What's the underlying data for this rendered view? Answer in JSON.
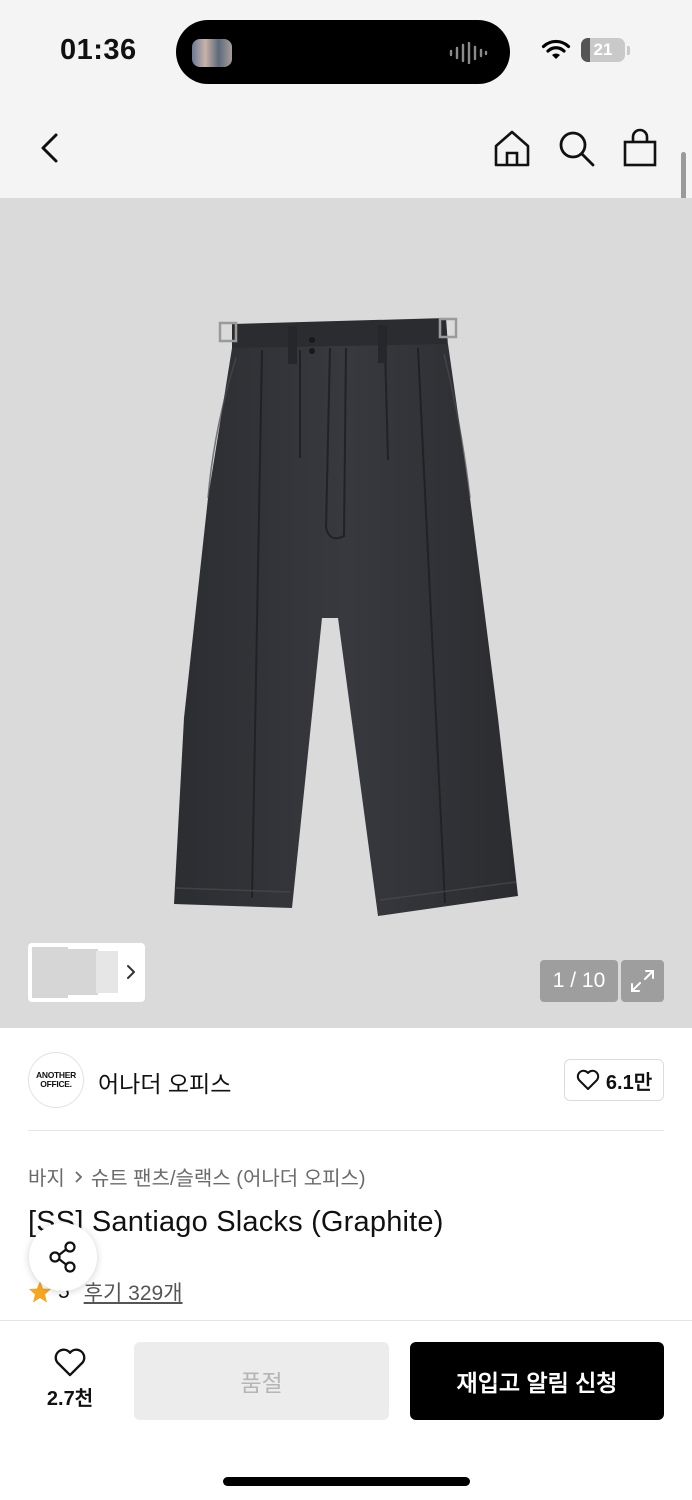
{
  "status": {
    "time": "01:36",
    "battery": "21"
  },
  "gallery": {
    "counter": "1 / 10",
    "battery_level": 0.21
  },
  "brand": {
    "logo_line1": "ANOTHER",
    "logo_line2": "OFFICE.",
    "name": "어나더 오피스",
    "likes": "6.1만"
  },
  "breadcrumb": {
    "level1": "바지",
    "level2": "슈트 팬츠/슬랙스 (어나더 오피스)"
  },
  "product": {
    "title": "[SS] Santiago Slacks (Graphite)",
    "rating": "5",
    "reviews": "후기 329개"
  },
  "bottom": {
    "wish_count": "2.7천",
    "soldout_label": "품절",
    "restock_label": "재입고 알림 신청"
  },
  "colors": {
    "accent": "#000000",
    "star": "#f5a623",
    "image_bg": "#dadada"
  },
  "icons": [
    "back-icon",
    "home-icon",
    "search-icon",
    "bag-icon",
    "expand-icon",
    "heart-icon",
    "star-icon",
    "share-icon"
  ]
}
